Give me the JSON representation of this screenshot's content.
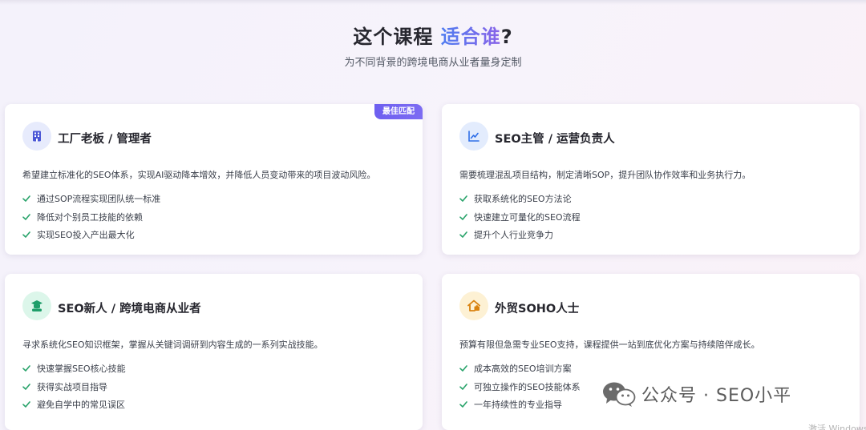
{
  "header": {
    "title_prefix": "这个课程",
    "title_accent": "适合谁",
    "title_suffix": "?",
    "subtitle": "为不同背景的跨境电商从业者量身定制"
  },
  "cards": [
    {
      "title": "工厂老板 / 管理者",
      "icon": "building-icon",
      "icon_bg": "#e7ebfc",
      "icon_color": "#4b57d6",
      "badge": "最佳匹配",
      "description": "希望建立标准化的SEO体系，实现AI驱动降本增效，并降低人员变动带来的项目波动风险。",
      "features": [
        "通过SOP流程实现团队统一标准",
        "降低对个别员工技能的依赖",
        "实现SEO投入产出最大化"
      ]
    },
    {
      "title": "SEO主管 / 运营负责人",
      "icon": "chart-line-icon",
      "icon_bg": "#e3ecfd",
      "icon_color": "#2f6fe8",
      "description": "需要梳理混乱项目结构，制定清晰SOP，提升团队协作效率和业务执行力。",
      "features": [
        "获取系统化的SEO方法论",
        "快速建立可量化的SEO流程",
        "提升个人行业竞争力"
      ]
    },
    {
      "title": "SEO新人 / 跨境电商从业者",
      "icon": "graduate-icon",
      "icon_bg": "#dcf6ea",
      "icon_color": "#1f9e6a",
      "description": "寻求系统化SEO知识框架，掌握从关键词调研到内容生成的一系列实战技能。",
      "features": [
        "快速掌握SEO核心技能",
        "获得实战项目指导",
        "避免自学中的常见误区"
      ]
    },
    {
      "title": "外贸SOHO人士",
      "icon": "home-office-icon",
      "icon_bg": "#fdf1d4",
      "icon_color": "#d9820f",
      "description": "预算有限但急需专业SEO支持，课程提供一站到底优化方案与持续陪伴成长。",
      "features": [
        "成本高效的SEO培训方案",
        "可独立操作的SEO技能体系",
        "一年持续性的专业指导"
      ]
    }
  ],
  "colors": {
    "check": "#28a36a",
    "accent_start": "#4f7cf0",
    "accent_end": "#8a63e8",
    "badge": "#6d5ff0"
  },
  "watermark": {
    "text": "公众号 · SEO小平",
    "icon": "wechat-icon"
  },
  "activation_text": "激活 Windows"
}
